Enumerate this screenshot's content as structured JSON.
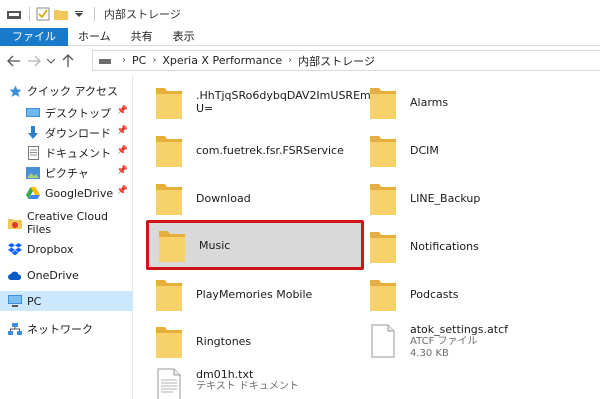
{
  "titlebar": {
    "title": "内部ストレージ"
  },
  "ribbon": {
    "tabs": [
      {
        "label": "ファイル"
      },
      {
        "label": "ホーム"
      },
      {
        "label": "共有"
      },
      {
        "label": "表示"
      }
    ]
  },
  "address": {
    "crumbs": [
      "PC",
      "Xperia X Performance",
      "内部ストレージ"
    ]
  },
  "sidebar": {
    "items": [
      {
        "label": "クイック アクセス",
        "icon": "star-icon"
      },
      {
        "label": "デスクトップ",
        "icon": "desktop-icon"
      },
      {
        "label": "ダウンロード",
        "icon": "download-icon"
      },
      {
        "label": "ドキュメント",
        "icon": "document-icon"
      },
      {
        "label": "ピクチャ",
        "icon": "pictures-icon"
      },
      {
        "label": "GoogleDrive",
        "icon": "googledrive-icon"
      },
      {
        "label": "Creative Cloud Files",
        "icon": "creative-cloud-icon"
      },
      {
        "label": "Dropbox",
        "icon": "dropbox-icon"
      },
      {
        "label": "OneDrive",
        "icon": "onedrive-icon"
      },
      {
        "label": "PC",
        "icon": "pc-icon"
      },
      {
        "label": "ネットワーク",
        "icon": "network-icon"
      }
    ]
  },
  "files": {
    "items": [
      {
        "name": ".HhTjqSRo6dybqDAV2ImUSREmnZ",
        "name2": "U=",
        "kind": "folder"
      },
      {
        "name": "Alarms",
        "kind": "folder"
      },
      {
        "name": "com.fuetrek.fsr.FSRService",
        "kind": "folder"
      },
      {
        "name": "DCIM",
        "kind": "folder"
      },
      {
        "name": "Download",
        "kind": "folder"
      },
      {
        "name": "LINE_Backup",
        "kind": "folder"
      },
      {
        "name": "Music",
        "kind": "folder"
      },
      {
        "name": "Notifications",
        "kind": "folder"
      },
      {
        "name": "PlayMemories Mobile",
        "kind": "folder"
      },
      {
        "name": "Podcasts",
        "kind": "folder"
      },
      {
        "name": "Ringtones",
        "kind": "folder"
      },
      {
        "name": "atok_settings.atcf",
        "type": "ATCF ファイル",
        "size": "4.30 KB",
        "kind": "file"
      },
      {
        "name": "dm01h.txt",
        "type": "テキスト ドキュメント",
        "kind": "file"
      }
    ]
  },
  "colors": {
    "accent": "#1979ca",
    "highlight_border": "#d0121b",
    "folder": "#f3c659"
  }
}
